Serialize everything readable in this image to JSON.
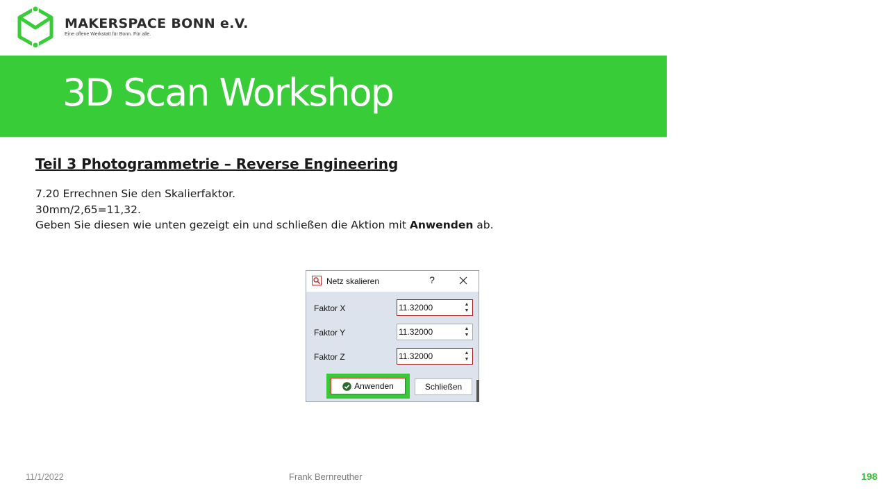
{
  "logo": {
    "name": "MAKERSPACE BONN e.V.",
    "tagline": "Eine offene Werkstatt für Bonn. Für alle."
  },
  "banner": {
    "title": "3D Scan Workshop"
  },
  "content": {
    "section_title": "Teil 3  Photogrammetrie  – Reverse Engineering",
    "line1": "7.20 Errechnen Sie den Skalierfaktor.",
    "line2": "30mm/2,65=11,32.",
    "line3_before": "Geben Sie diesen wie unten gezeigt ein und schließen die Aktion mit ",
    "line3_bold": "Anwenden",
    "line3_after": " ab."
  },
  "dialog": {
    "title": "Netz skalieren",
    "help": "?",
    "fields": [
      {
        "label": "Faktor X",
        "value": "11.32000"
      },
      {
        "label": "Faktor Y",
        "value": "11.32000"
      },
      {
        "label": "Faktor Z",
        "value": "11.32000"
      }
    ],
    "apply_label": "Anwenden",
    "close_label": "Schließen"
  },
  "footer": {
    "date": "11/1/2022",
    "author": "Frank Bernreuther",
    "page": "198"
  },
  "colors": {
    "accent_green": "#38cc38",
    "focus_red": "#a01c1c"
  },
  "icons": [
    "hexagon-logo-icon",
    "magnifier-app-icon",
    "help-icon",
    "close-icon",
    "spin-up-icon",
    "spin-down-icon",
    "check-circle-icon"
  ]
}
